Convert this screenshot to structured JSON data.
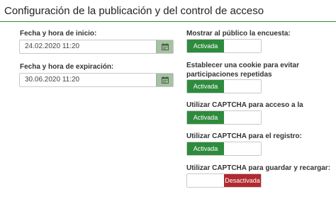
{
  "panel": {
    "title": "Configuración de la publicación y del control de acceso"
  },
  "start": {
    "label": "Fecha y hora de inicio:",
    "value": "24.02.2020 11:20"
  },
  "end": {
    "label": "Fecha y hora de expiración:",
    "value": "30.06.2020 11:20"
  },
  "toggles": [
    {
      "label": "Mostrar al público la encuesta:",
      "state_label": "Activada",
      "state": "on"
    },
    {
      "label": "Establecer una cookie para evitar participaciones repetidas",
      "state_label": "Activada",
      "state": "on"
    },
    {
      "label": "Utilizar CAPTCHA para acceso a la encuesta:",
      "state_label": "Activada",
      "state": "on"
    },
    {
      "label": "Utilizar CAPTCHA para el registro:",
      "state_label": "Activada",
      "state": "on"
    },
    {
      "label": "Utilizar CAPTCHA para guardar y recargar:",
      "state_label": "Desactivada",
      "state": "off"
    }
  ],
  "icons": {
    "calendar": "calendar-icon"
  },
  "colors": {
    "accent": "#2e8b3d",
    "danger": "#b02a30",
    "calendar_button": "#a5c2a2"
  }
}
